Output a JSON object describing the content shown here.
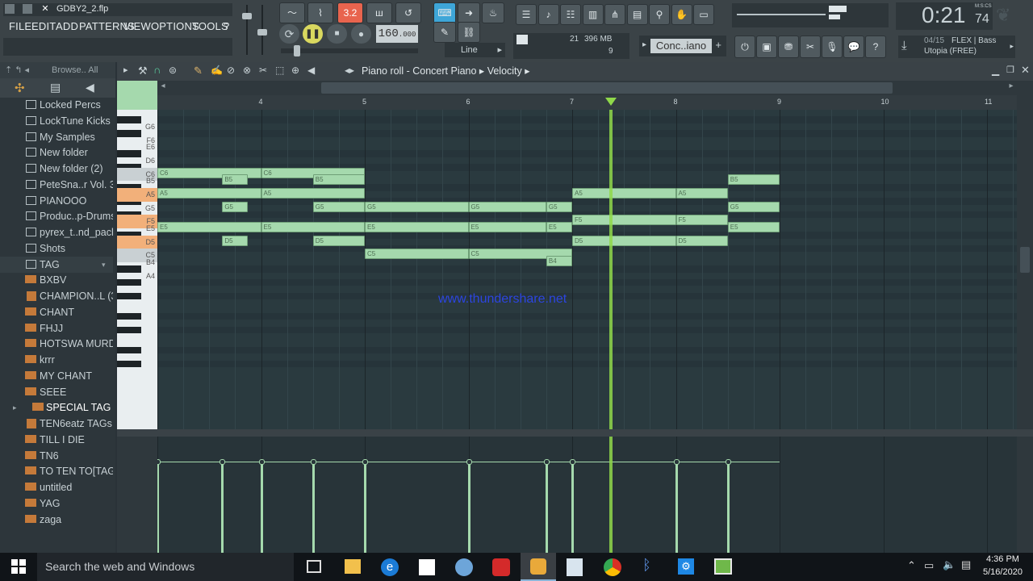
{
  "window": {
    "file_name": "GDBY2_2.flp"
  },
  "menu": [
    "FILE",
    "EDIT",
    "ADD",
    "PATTERNS",
    "VIEW",
    "OPTIONS",
    "TOOLS",
    "?"
  ],
  "transport": {
    "pattern_label": "3.2",
    "tempo": "160",
    "tempo_decimal": ".000",
    "snap_mode": "Line",
    "time": "0:21",
    "time_sub": "74",
    "time_unit": "M:S:CS"
  },
  "cpu": {
    "value": "21",
    "memory": "396 MB",
    "polyphony": "9"
  },
  "channel": {
    "name": "Conc..iano"
  },
  "news": {
    "count": "04/15",
    "title": "FLEX | Bass",
    "subtitle": "Utopia (FREE)"
  },
  "browser": {
    "header": "Browse.. All",
    "items": [
      {
        "label": "Locked Percs",
        "type": "folder"
      },
      {
        "label": "LockTune Kicks",
        "type": "folder"
      },
      {
        "label": "My Samples",
        "type": "folder"
      },
      {
        "label": "New folder",
        "type": "folder"
      },
      {
        "label": "New folder (2)",
        "type": "folder"
      },
      {
        "label": "PeteSna..r Vol. 3",
        "type": "folder"
      },
      {
        "label": "PIANOOO",
        "type": "folder"
      },
      {
        "label": "Produc..p-Drums",
        "type": "folder"
      },
      {
        "label": "pyrex_t..nd_pack",
        "type": "folder"
      },
      {
        "label": "Shots",
        "type": "folder"
      },
      {
        "label": "TAG",
        "type": "folder-open"
      },
      {
        "label": "BXBV",
        "type": "mp3"
      },
      {
        "label": "CHAMPION..L (32)",
        "type": "folder-sub"
      },
      {
        "label": "CHANT",
        "type": "mp3"
      },
      {
        "label": "FHJJ",
        "type": "mp3"
      },
      {
        "label": "HOTSWA MURD",
        "type": "mp3"
      },
      {
        "label": "krrr",
        "type": "mp3"
      },
      {
        "label": "MY CHANT",
        "type": "mp3"
      },
      {
        "label": "SEEE",
        "type": "mp3"
      },
      {
        "label": "SPECIAL TAG",
        "type": "mp3-selected"
      },
      {
        "label": "TEN6eatz TAGs",
        "type": "folder-sub"
      },
      {
        "label": "TILL I DIE",
        "type": "mp3"
      },
      {
        "label": "TN6",
        "type": "mp3"
      },
      {
        "label": "TO TEN TO[TAG]",
        "type": "mp3"
      },
      {
        "label": "untitled",
        "type": "mp3"
      },
      {
        "label": "YAG",
        "type": "mp3"
      },
      {
        "label": "zaga",
        "type": "mp3"
      }
    ]
  },
  "piano_roll": {
    "breadcrumb": [
      "Piano roll",
      "Concert Piano",
      "Velocity"
    ],
    "bars": [
      "4",
      "5",
      "6",
      "7",
      "8",
      "9",
      "10",
      "11"
    ],
    "key_labels": [
      "G6",
      "F6",
      "E6",
      "D6",
      "C6",
      "B5",
      "A5",
      "G5",
      "F5",
      "E5",
      "D5",
      "C5",
      "B4",
      "A4"
    ],
    "watermark": "www.thundershare.net",
    "notes": [
      {
        "pitch": "C6",
        "start": 3,
        "len": 1
      },
      {
        "pitch": "C6",
        "start": 4,
        "len": 1
      },
      {
        "pitch": "B5",
        "start": 3.625,
        "len": 0.25
      },
      {
        "pitch": "B5",
        "start": 4.5,
        "len": 0.5
      },
      {
        "pitch": "B5",
        "start": 8.5,
        "len": 0.5
      },
      {
        "pitch": "A5",
        "start": 3,
        "len": 1
      },
      {
        "pitch": "A5",
        "start": 4,
        "len": 1
      },
      {
        "pitch": "A5",
        "start": 7,
        "len": 1
      },
      {
        "pitch": "A5",
        "start": 8,
        "len": 0.5
      },
      {
        "pitch": "G5",
        "start": 3.625,
        "len": 0.25
      },
      {
        "pitch": "G5",
        "start": 4.5,
        "len": 0.5
      },
      {
        "pitch": "G5",
        "start": 5,
        "len": 1
      },
      {
        "pitch": "G5",
        "start": 6,
        "len": 0.75
      },
      {
        "pitch": "G5",
        "start": 6.75,
        "len": 0.25
      },
      {
        "pitch": "G5",
        "start": 8.5,
        "len": 0.5
      },
      {
        "pitch": "F5",
        "start": 7,
        "len": 1
      },
      {
        "pitch": "F5",
        "start": 8,
        "len": 0.5
      },
      {
        "pitch": "E5",
        "start": 3,
        "len": 1
      },
      {
        "pitch": "E5",
        "start": 4,
        "len": 1
      },
      {
        "pitch": "E5",
        "start": 5,
        "len": 1
      },
      {
        "pitch": "E5",
        "start": 6,
        "len": 0.75
      },
      {
        "pitch": "E5",
        "start": 6.75,
        "len": 0.25
      },
      {
        "pitch": "E5",
        "start": 8.5,
        "len": 0.5
      },
      {
        "pitch": "D5",
        "start": 3.625,
        "len": 0.25
      },
      {
        "pitch": "D5",
        "start": 4.5,
        "len": 0.5
      },
      {
        "pitch": "D5",
        "start": 7,
        "len": 1
      },
      {
        "pitch": "D5",
        "start": 8,
        "len": 0.5
      },
      {
        "pitch": "C5",
        "start": 5,
        "len": 1
      },
      {
        "pitch": "C5",
        "start": 6,
        "len": 1
      },
      {
        "pitch": "B4",
        "start": 6.75,
        "len": 0.25
      }
    ],
    "playhead_bar": 7.375
  },
  "taskbar": {
    "search_placeholder": "Search the web and Windows",
    "time": "4:36 PM",
    "date": "5/16/2020"
  },
  "colors": {
    "note_fill": "#a5d9ad",
    "playhead": "#8fd84a",
    "key_highlight": "#f2b07a"
  }
}
